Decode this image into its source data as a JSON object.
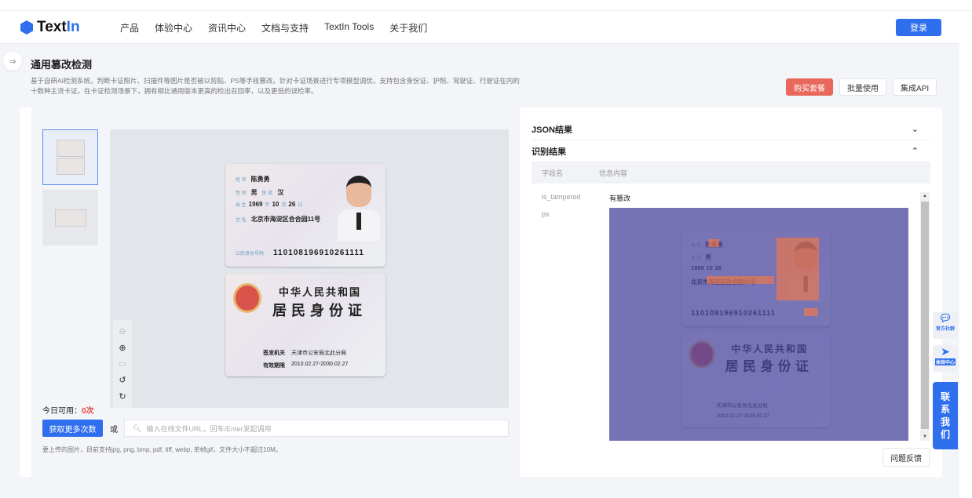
{
  "brand": {
    "name_a": "Text",
    "name_b": "In"
  },
  "nav": {
    "items": [
      "产品",
      "体验中心",
      "资讯中心",
      "文档与支持",
      "TextIn Tools",
      "关于我们"
    ],
    "login": "登录"
  },
  "page": {
    "title": "通用篡改检测",
    "description": "基于自研AI检测系统，判断卡证照片、扫描件等图片是否被以剪贴、PS等手段篡改。针对卡证场景进行专项模型调优，支持包含身份证、护照、驾驶证、行驶证在内的十数种主流卡证。在卡证检测场景下，拥有相比通用版本更高的检出召回率，以及更低的误检率。",
    "buttons": {
      "buy": "购买套餐",
      "batch": "批量使用",
      "api": "集成API"
    }
  },
  "id_card": {
    "front": {
      "name_label": "姓 名",
      "name": "陈勇勇",
      "sex_label": "性 别",
      "sex": "男",
      "ethnic_label": "民 族",
      "ethnic": "汉",
      "birth_label": "出 生",
      "year": "1969",
      "year_unit": "年",
      "month": "10",
      "month_unit": "月",
      "day": "26",
      "day_unit": "日",
      "addr_label": "住 址",
      "addr": "北京市海淀区合合园11号",
      "id_label": "公民身份号码",
      "id": "110108196910261111"
    },
    "back": {
      "title1": "中华人民共和国",
      "title2": "居民身份证",
      "issuer_label": "签发机关",
      "issuer": "天津市公安局北此分局",
      "valid_label": "有效期限",
      "valid": "2010.02.27-2030.02.27"
    }
  },
  "upload": {
    "avail_label": "今日可用：",
    "avail_value": "0次",
    "more_button": "获取更多次数",
    "or": "或",
    "url_placeholder": "输入在线文件URL，回车/Enter发起调用",
    "hint": "要上传的图片，目前支持jpg, png, bmp, pdf, tiff, webp, 单帧gif，文件大小不超过10M。"
  },
  "results": {
    "json_title": "JSON结果",
    "recog_title": "识别结果",
    "col_field": "字段名",
    "col_info": "信息内容",
    "rows": [
      {
        "field": "is_tampered",
        "value": "有篡改"
      },
      {
        "field": "ps",
        "value": ""
      }
    ],
    "feedback": "问题反馈"
  },
  "float": {
    "community": "官方社群",
    "experience": "体验中心",
    "contact": [
      "联",
      "系",
      "我",
      "们"
    ]
  },
  "colors": {
    "accent": "#2f6fed",
    "buy": "#e8685c",
    "overlay": "#6b6aa8"
  }
}
